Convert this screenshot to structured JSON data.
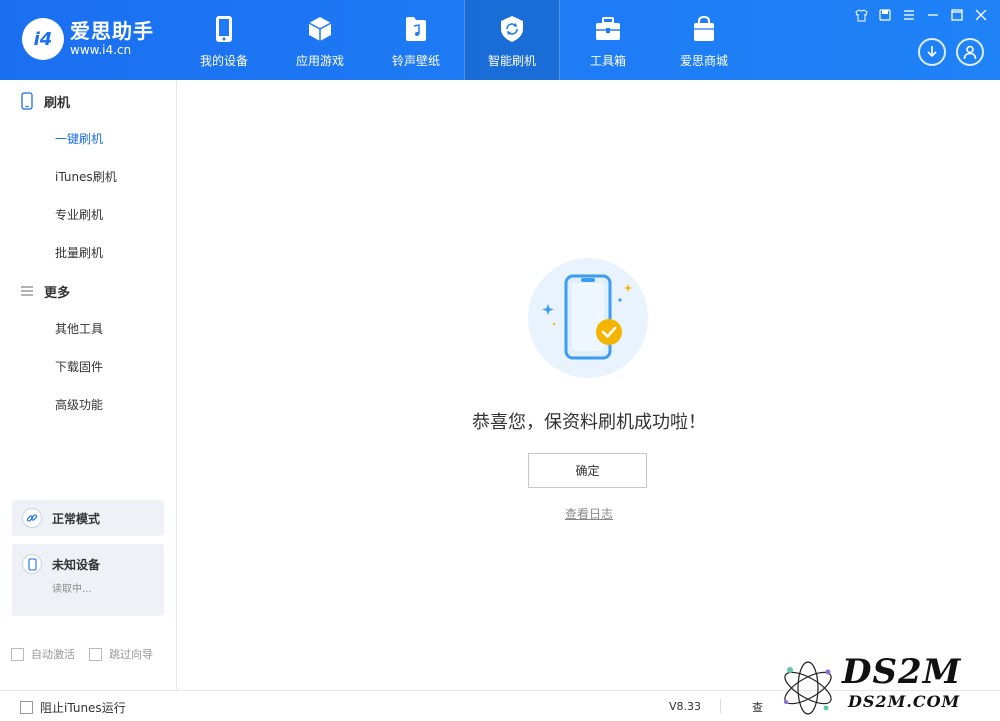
{
  "app": {
    "logo_badge": "i4",
    "name": "爱思助手",
    "url": "www.i4.cn"
  },
  "nav": [
    {
      "label": "我的设备",
      "icon": "phone-icon"
    },
    {
      "label": "应用游戏",
      "icon": "cube-icon"
    },
    {
      "label": "铃声壁纸",
      "icon": "music-file-icon"
    },
    {
      "label": "智能刷机",
      "icon": "refresh-shield-icon",
      "active": true
    },
    {
      "label": "工具箱",
      "icon": "toolbox-icon"
    },
    {
      "label": "爱思商城",
      "icon": "shopping-bag-icon"
    }
  ],
  "sidebar": {
    "section1": {
      "title": "刷机",
      "icon": "phone-outline-icon"
    },
    "flash_items": [
      "一键刷机",
      "iTunes刷机",
      "专业刷机",
      "批量刷机"
    ],
    "section2": {
      "title": "更多",
      "icon": "menu-icon"
    },
    "more_items": [
      "其他工具",
      "下载固件",
      "高级功能"
    ],
    "mode": {
      "label": "正常模式",
      "icon": "link-icon"
    },
    "device": {
      "title": "未知设备",
      "status": "读取中...",
      "icon": "phone-small-icon"
    },
    "checks": [
      "自动激活",
      "跳过向导"
    ]
  },
  "main": {
    "message": "恭喜您，保资料刷机成功啦！",
    "confirm": "确定",
    "log_link": "查看日志"
  },
  "status": {
    "itunes": "阻止iTunes运行",
    "version": "V8.33",
    "more": "查"
  },
  "watermark": {
    "main": "DS2M",
    "sub": "DS2M.COM"
  },
  "colors": {
    "accent": "#1a6ff0",
    "header": "#1e7bf5",
    "check_badge": "#f5b400"
  }
}
